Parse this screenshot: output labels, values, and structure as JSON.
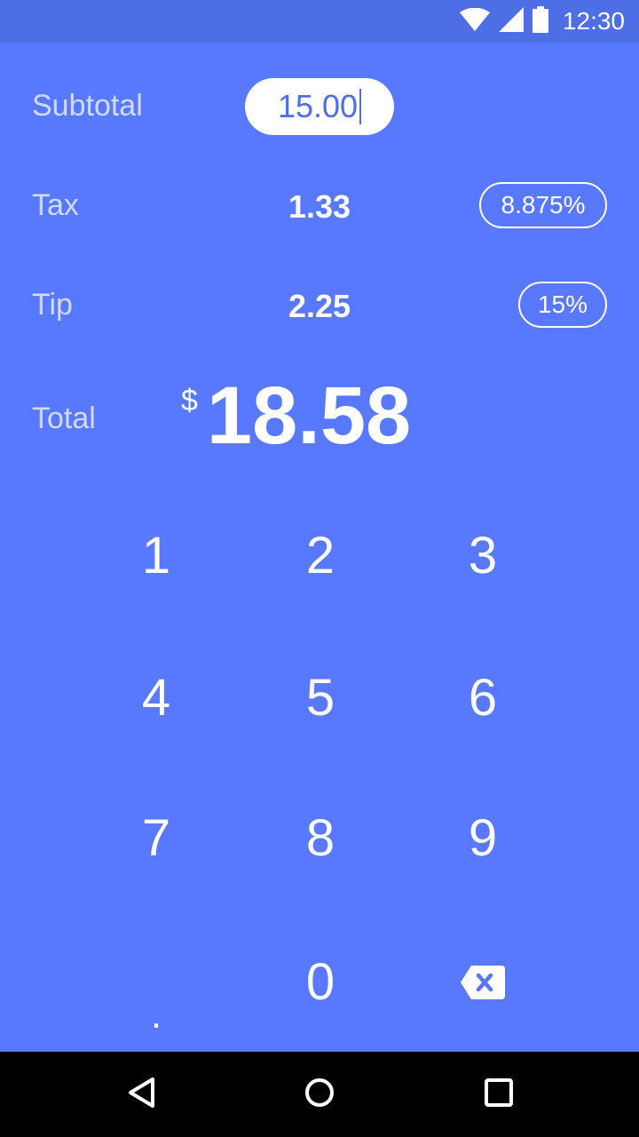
{
  "status_bar": {
    "time": "12:30",
    "icons": [
      "wifi-icon",
      "signal-icon",
      "battery-icon"
    ]
  },
  "rows": {
    "subtotal": {
      "label": "Subtotal",
      "value": "15.00"
    },
    "tax": {
      "label": "Tax",
      "value": "1.33",
      "rate": "8.875%"
    },
    "tip": {
      "label": "Tip",
      "value": "2.25",
      "rate": "15%"
    },
    "total": {
      "label": "Total",
      "currency": "$",
      "value": "18.58"
    }
  },
  "keypad": {
    "keys": [
      "1",
      "2",
      "3",
      "4",
      "5",
      "6",
      "7",
      "8",
      "9",
      ".",
      "0"
    ],
    "backspace_icon": "backspace-icon"
  },
  "nav_bar": {
    "icons": [
      "back-icon",
      "home-icon",
      "recents-icon"
    ]
  },
  "colors": {
    "background": "#5879FD",
    "status_bar": "#4E6EE6",
    "text": "#FFFFFF",
    "nav_bar": "#000000"
  }
}
